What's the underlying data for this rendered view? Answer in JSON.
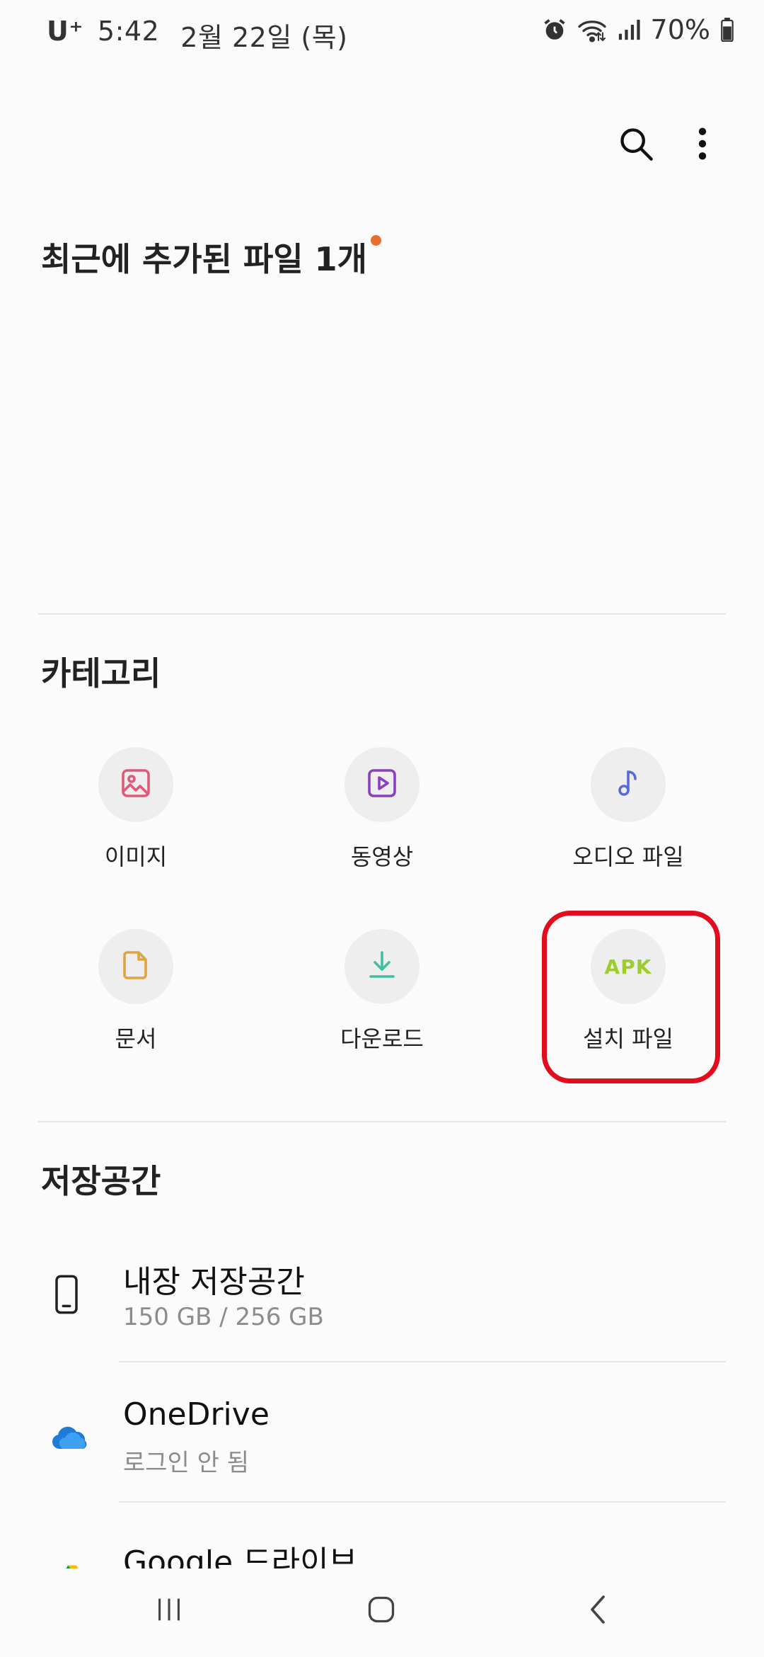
{
  "status_bar": {
    "carrier": "U⁺",
    "time": "5:42",
    "date": "2월 22일 (목)",
    "battery": "70%",
    "icons": [
      "alarm-icon",
      "wifi-icon",
      "signal-icon",
      "battery-icon"
    ]
  },
  "toolbar": {
    "icons": [
      "search-icon",
      "more-vert-icon"
    ]
  },
  "recent": {
    "title": "최근에 추가된 파일 1개"
  },
  "categories": {
    "title": "카테고리",
    "items": [
      {
        "label": "이미지",
        "icon": "image-icon",
        "color": "#e0587a"
      },
      {
        "label": "동영상",
        "icon": "video-icon",
        "color": "#8a3fc2"
      },
      {
        "label": "오디오 파일",
        "icon": "music-note-icon",
        "color": "#5b6bd6"
      },
      {
        "label": "문서",
        "icon": "document-icon",
        "color": "#e0a440"
      },
      {
        "label": "다운로드",
        "icon": "download-icon",
        "color": "#3fbfa0"
      },
      {
        "label": "설치 파일",
        "icon": "apk-icon",
        "icon_text": "APK",
        "color": "#9ccd2c"
      }
    ]
  },
  "storage": {
    "title": "저장공간",
    "items": [
      {
        "title": "내장 저장공간",
        "subtitle": "150 GB / 256 GB",
        "icon": "phone-icon"
      },
      {
        "title": "OneDrive",
        "subtitle": "로그인 안 됨",
        "icon": "onedrive-icon"
      },
      {
        "title": "Google 드라이브",
        "subtitle": "",
        "icon": "google-drive-icon"
      }
    ]
  },
  "nav_bar": {
    "icons": [
      "recent-apps-icon",
      "home-icon",
      "back-icon"
    ]
  },
  "colors": {
    "background": "#fbfbfb",
    "accent_dot": "#e76f2c",
    "highlight": "#e10d1d"
  }
}
